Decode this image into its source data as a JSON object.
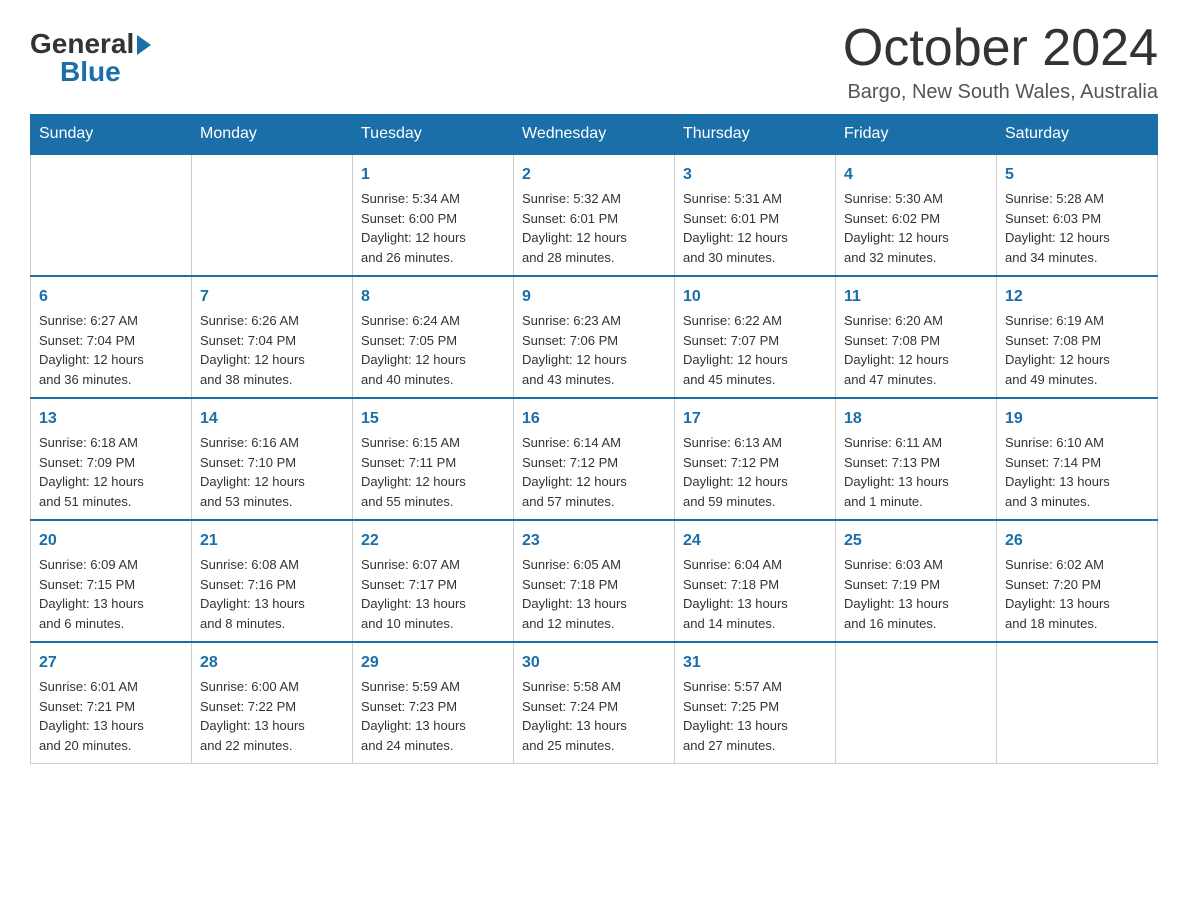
{
  "logo": {
    "general": "General",
    "blue": "Blue",
    "triangle": "▶"
  },
  "title": "October 2024",
  "location": "Bargo, New South Wales, Australia",
  "headers": [
    "Sunday",
    "Monday",
    "Tuesday",
    "Wednesday",
    "Thursday",
    "Friday",
    "Saturday"
  ],
  "weeks": [
    [
      {
        "day": "",
        "info": ""
      },
      {
        "day": "",
        "info": ""
      },
      {
        "day": "1",
        "info": "Sunrise: 5:34 AM\nSunset: 6:00 PM\nDaylight: 12 hours\nand 26 minutes."
      },
      {
        "day": "2",
        "info": "Sunrise: 5:32 AM\nSunset: 6:01 PM\nDaylight: 12 hours\nand 28 minutes."
      },
      {
        "day": "3",
        "info": "Sunrise: 5:31 AM\nSunset: 6:01 PM\nDaylight: 12 hours\nand 30 minutes."
      },
      {
        "day": "4",
        "info": "Sunrise: 5:30 AM\nSunset: 6:02 PM\nDaylight: 12 hours\nand 32 minutes."
      },
      {
        "day": "5",
        "info": "Sunrise: 5:28 AM\nSunset: 6:03 PM\nDaylight: 12 hours\nand 34 minutes."
      }
    ],
    [
      {
        "day": "6",
        "info": "Sunrise: 6:27 AM\nSunset: 7:04 PM\nDaylight: 12 hours\nand 36 minutes."
      },
      {
        "day": "7",
        "info": "Sunrise: 6:26 AM\nSunset: 7:04 PM\nDaylight: 12 hours\nand 38 minutes."
      },
      {
        "day": "8",
        "info": "Sunrise: 6:24 AM\nSunset: 7:05 PM\nDaylight: 12 hours\nand 40 minutes."
      },
      {
        "day": "9",
        "info": "Sunrise: 6:23 AM\nSunset: 7:06 PM\nDaylight: 12 hours\nand 43 minutes."
      },
      {
        "day": "10",
        "info": "Sunrise: 6:22 AM\nSunset: 7:07 PM\nDaylight: 12 hours\nand 45 minutes."
      },
      {
        "day": "11",
        "info": "Sunrise: 6:20 AM\nSunset: 7:08 PM\nDaylight: 12 hours\nand 47 minutes."
      },
      {
        "day": "12",
        "info": "Sunrise: 6:19 AM\nSunset: 7:08 PM\nDaylight: 12 hours\nand 49 minutes."
      }
    ],
    [
      {
        "day": "13",
        "info": "Sunrise: 6:18 AM\nSunset: 7:09 PM\nDaylight: 12 hours\nand 51 minutes."
      },
      {
        "day": "14",
        "info": "Sunrise: 6:16 AM\nSunset: 7:10 PM\nDaylight: 12 hours\nand 53 minutes."
      },
      {
        "day": "15",
        "info": "Sunrise: 6:15 AM\nSunset: 7:11 PM\nDaylight: 12 hours\nand 55 minutes."
      },
      {
        "day": "16",
        "info": "Sunrise: 6:14 AM\nSunset: 7:12 PM\nDaylight: 12 hours\nand 57 minutes."
      },
      {
        "day": "17",
        "info": "Sunrise: 6:13 AM\nSunset: 7:12 PM\nDaylight: 12 hours\nand 59 minutes."
      },
      {
        "day": "18",
        "info": "Sunrise: 6:11 AM\nSunset: 7:13 PM\nDaylight: 13 hours\nand 1 minute."
      },
      {
        "day": "19",
        "info": "Sunrise: 6:10 AM\nSunset: 7:14 PM\nDaylight: 13 hours\nand 3 minutes."
      }
    ],
    [
      {
        "day": "20",
        "info": "Sunrise: 6:09 AM\nSunset: 7:15 PM\nDaylight: 13 hours\nand 6 minutes."
      },
      {
        "day": "21",
        "info": "Sunrise: 6:08 AM\nSunset: 7:16 PM\nDaylight: 13 hours\nand 8 minutes."
      },
      {
        "day": "22",
        "info": "Sunrise: 6:07 AM\nSunset: 7:17 PM\nDaylight: 13 hours\nand 10 minutes."
      },
      {
        "day": "23",
        "info": "Sunrise: 6:05 AM\nSunset: 7:18 PM\nDaylight: 13 hours\nand 12 minutes."
      },
      {
        "day": "24",
        "info": "Sunrise: 6:04 AM\nSunset: 7:18 PM\nDaylight: 13 hours\nand 14 minutes."
      },
      {
        "day": "25",
        "info": "Sunrise: 6:03 AM\nSunset: 7:19 PM\nDaylight: 13 hours\nand 16 minutes."
      },
      {
        "day": "26",
        "info": "Sunrise: 6:02 AM\nSunset: 7:20 PM\nDaylight: 13 hours\nand 18 minutes."
      }
    ],
    [
      {
        "day": "27",
        "info": "Sunrise: 6:01 AM\nSunset: 7:21 PM\nDaylight: 13 hours\nand 20 minutes."
      },
      {
        "day": "28",
        "info": "Sunrise: 6:00 AM\nSunset: 7:22 PM\nDaylight: 13 hours\nand 22 minutes."
      },
      {
        "day": "29",
        "info": "Sunrise: 5:59 AM\nSunset: 7:23 PM\nDaylight: 13 hours\nand 24 minutes."
      },
      {
        "day": "30",
        "info": "Sunrise: 5:58 AM\nSunset: 7:24 PM\nDaylight: 13 hours\nand 25 minutes."
      },
      {
        "day": "31",
        "info": "Sunrise: 5:57 AM\nSunset: 7:25 PM\nDaylight: 13 hours\nand 27 minutes."
      },
      {
        "day": "",
        "info": ""
      },
      {
        "day": "",
        "info": ""
      }
    ]
  ]
}
